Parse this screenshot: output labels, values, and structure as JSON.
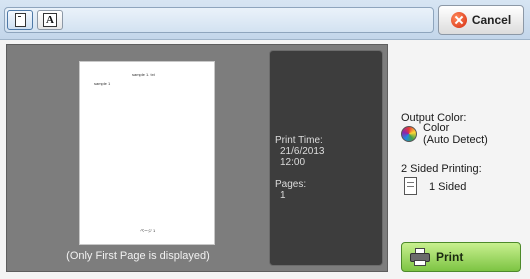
{
  "toolbar": {
    "cancel_label": "Cancel",
    "mode_buttons": [
      {
        "icon": "portrait-page-icon",
        "selected": true
      },
      {
        "icon": "letter-a-icon",
        "selected": false
      }
    ]
  },
  "preview": {
    "thumbnail": {
      "header_right": "sample 1. txt",
      "header_left": "sample 1",
      "footer": "ページ 1"
    },
    "caption": "(Only First Page is displayed)",
    "info": {
      "print_time_label": "Print Time:",
      "print_time_date": "21/6/2013",
      "print_time_clock": "12:00",
      "pages_label": "Pages:",
      "pages_value": "1"
    }
  },
  "settings": {
    "output_color_label": "Output Color:",
    "output_color_value_line1": "Color",
    "output_color_value_line2": "(Auto Detect)",
    "two_sided_label": "2 Sided Printing:",
    "two_sided_value": "1 Sided"
  },
  "actions": {
    "print_label": "Print"
  },
  "colors": {
    "top_bar": "#c9dbee",
    "preview_background": "#7d7d7d",
    "info_panel": "#3d3d3d",
    "print_button": "#8fd14f",
    "cancel_icon": "#e0401d"
  }
}
